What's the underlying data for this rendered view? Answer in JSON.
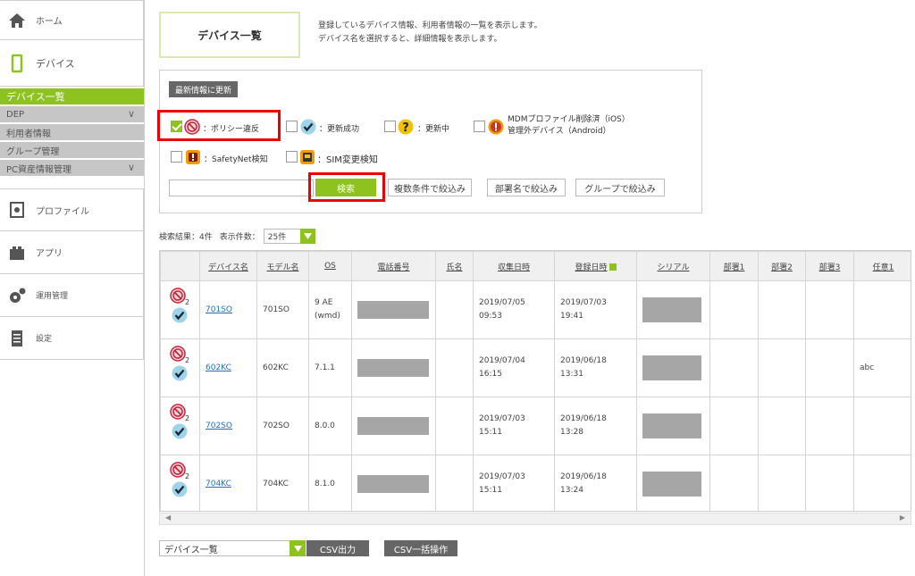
{
  "sidebar": {
    "home": "ホーム",
    "device": "デバイス",
    "sub": [
      "デバイス一覧",
      "DEP",
      "利用者情報",
      "グループ管理",
      "PC資産情報管理"
    ],
    "profile": "プロファイル",
    "app": "アプリ",
    "ops": "運用管理",
    "settings": "設定"
  },
  "header": {
    "title": "デバイス一覧",
    "desc1": "登録しているデバイス情報、利用者情報の一覧を表示します。",
    "desc2": "デバイス名を選択すると、詳細情報を表示します。"
  },
  "filter": {
    "refresh": "最新情報に更新",
    "policy": "：ポリシー違反",
    "update_ok": "：更新成功",
    "updating": "：更新中",
    "mdm1": "MDMプロファイル削除済（iOS）",
    "mdm2": "管理外デバイス（Android）",
    "safetynet": "：SafetyNet検知",
    "sim": "：SIM変更検知",
    "search": "検索",
    "multi": "複数条件で絞込み",
    "dept": "部署名で絞込み",
    "group": "グループで絞込み"
  },
  "result": {
    "count": "検索結果：4件",
    "per_label": "表示件数：",
    "per_value": "25件"
  },
  "table": {
    "headers": [
      "",
      "デバイス名",
      "モデル名",
      "OS",
      "電話番号",
      "氏名",
      "収集日時",
      "登録日時",
      "シリアル",
      "部署1",
      "部署2",
      "部署3",
      "任意1"
    ],
    "rows": [
      {
        "name": "701SO",
        "model": "701SO",
        "os1": "9 AE",
        "os2": "(wmd)",
        "c1": "2019/07/05",
        "c2": "09:53",
        "r1": "2019/07/03",
        "r2": "19:41",
        "opt": ""
      },
      {
        "name": "602KC",
        "model": "602KC",
        "os1": "7.1.1",
        "os2": "",
        "c1": "2019/07/04",
        "c2": "16:15",
        "r1": "2019/06/18",
        "r2": "13:31",
        "opt": "abc"
      },
      {
        "name": "702SO",
        "model": "702SO",
        "os1": "8.0.0",
        "os2": "",
        "c1": "2019/07/03",
        "c2": "15:11",
        "r1": "2019/06/18",
        "r2": "13:28",
        "opt": ""
      },
      {
        "name": "704KC",
        "model": "704KC",
        "os1": "8.1.0",
        "os2": "",
        "c1": "2019/07/03",
        "c2": "15:11",
        "r1": "2019/06/18",
        "r2": "13:24",
        "opt": ""
      }
    ]
  },
  "bottom": {
    "select": "デバイス一覧",
    "csv_out": "CSV出力",
    "csv_bulk": "CSV一括操作"
  },
  "colors": {
    "accent": "#8dc21f",
    "highlight": "#e00000"
  }
}
